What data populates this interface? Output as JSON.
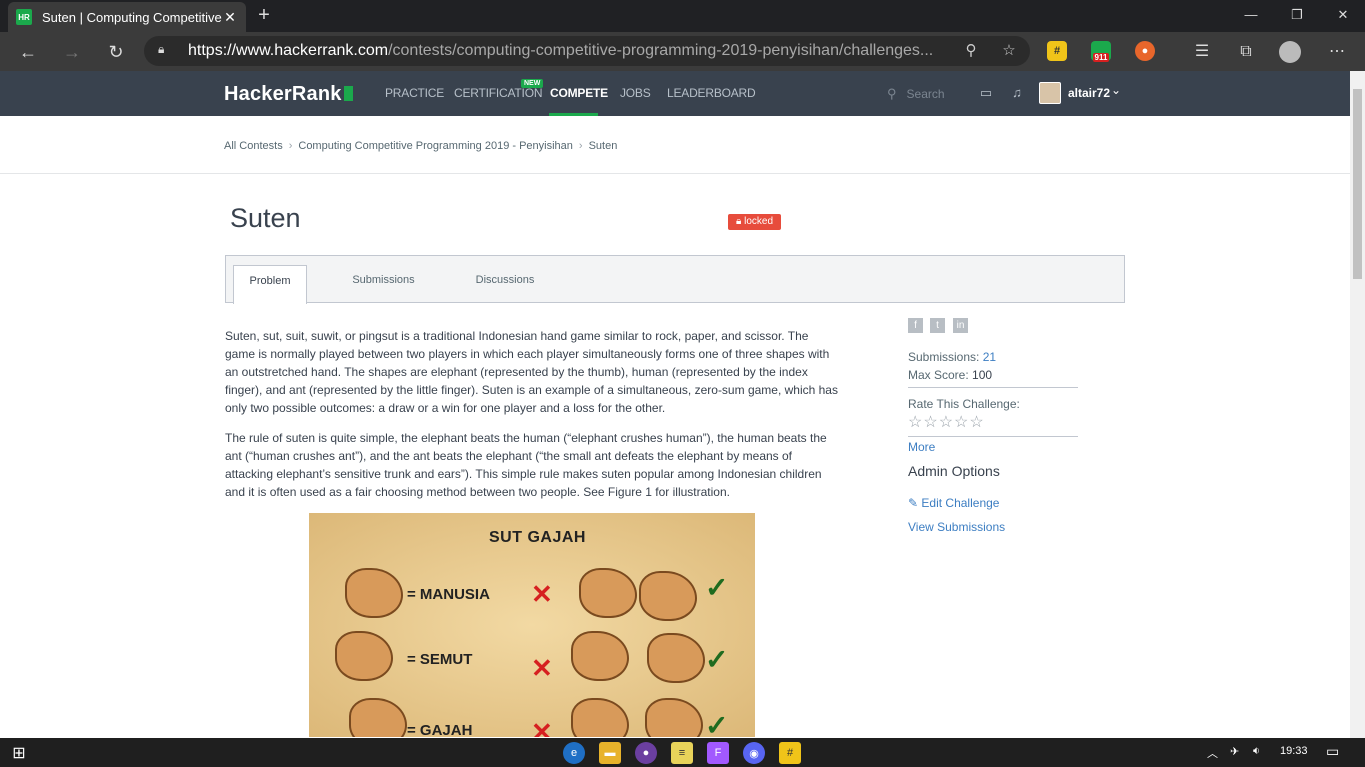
{
  "browser": {
    "tab_title": "Suten | Computing Competitive P",
    "tab_favicon": "HR",
    "url_host": "https://www.hackerrank.com",
    "url_path": "/contests/computing-competitive-programming-2019-penyisihan/challenges...",
    "ext_badge": "911"
  },
  "nav": {
    "logo": "HackerRank",
    "links": [
      "PRACTICE",
      "CERTIFICATION",
      "COMPETE",
      "JOBS",
      "LEADERBOARD"
    ],
    "new_badge": "NEW",
    "search_placeholder": "Search",
    "username": "altair72"
  },
  "breadcrumb": [
    "All Contests",
    "Computing Competitive Programming 2019 - Penyisihan",
    "Suten"
  ],
  "challenge": {
    "title": "Suten",
    "status": "locked",
    "tabs": [
      "Problem",
      "Submissions",
      "Discussions"
    ],
    "paragraphs": [
      "Suten, sut, suit, suwit, or pingsut is a traditional Indonesian hand game similar to rock, paper, and scissor. The game is normally played between two players in which each player simultaneously forms one of three shapes with an outstretched hand. The shapes are elephant (represented by the thumb), human (represented by the index finger), and ant (represented by the little finger). Suten is an example of a simultaneous, zero-sum game, which has only two possible outcomes: a draw or a win for one player and a loss for the other.",
      "The rule of suten is quite simple, the elephant beats the human (“elephant crushes human”), the human beats the ant (“human crushes ant”), and the ant beats the elephant (“the small ant defeats the elephant by means of attacking elephant’s sensitive trunk and ears”). This simple rule makes suten popular among Indonesian children and it is often used as a fair choosing method between two people. See Figure 1 for illustration."
    ],
    "figure": {
      "title": "SUT GAJAH",
      "rows": [
        "= MANUSIA",
        "= SEMUT",
        "= GAJAH"
      ]
    }
  },
  "sidebar": {
    "submissions_label": "Submissions:",
    "submissions_value": "21",
    "max_score_label": "Max Score:",
    "max_score_value": "100",
    "rate_label": "Rate This Challenge:",
    "more": "More",
    "admin_title": "Admin Options",
    "edit_challenge": "Edit Challenge",
    "view_submissions": "View Submissions"
  },
  "taskbar": {
    "time": "19:33"
  }
}
